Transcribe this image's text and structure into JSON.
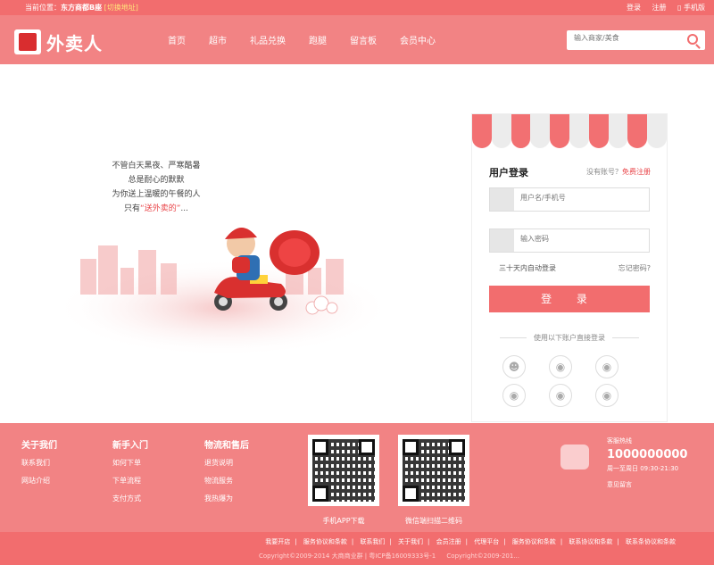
{
  "topbar": {
    "location_prefix": "当前位置：",
    "location": "东方商都B座",
    "switch": "[切换地址]",
    "login": "登录",
    "register": "注册",
    "mobile": "▯ 手机版"
  },
  "header": {
    "brand": "外卖人",
    "nav": [
      "首页",
      "超市",
      "礼品兑换",
      "跑腿",
      "留言板",
      "会员中心"
    ],
    "search_placeholder": "输入商家/美食"
  },
  "hero": {
    "lines": [
      "不管白天黑夜、严寒酷暑",
      "总是耐心的默默",
      "为你送上温暖的午餐的人"
    ],
    "last_prefix": "只有",
    "last_highlight": "“送外卖的”",
    "last_suffix": "..."
  },
  "login": {
    "title": "用户登录",
    "no_account": "没有账号？",
    "register_free": "免费注册",
    "username_placeholder": "用户名/手机号",
    "password_placeholder": "输入密码",
    "auto_login": "三十天内自动登录",
    "forgot": "忘记密码?",
    "submit": "登  录",
    "social_title": "使用以下账户直接登录",
    "socials": [
      "qq-icon",
      "weibo-icon",
      "weibo-icon",
      "weibo-icon",
      "weibo-icon",
      "weibo-icon"
    ],
    "awning_colors": [
      "#f27072",
      "#ececec"
    ]
  },
  "footer": {
    "columns": [
      {
        "title": "关于我们",
        "items": [
          "联系我们",
          "网站介绍"
        ]
      },
      {
        "title": "新手入门",
        "items": [
          "如何下单",
          "下单流程",
          "支付方式"
        ]
      },
      {
        "title": "物流和售后",
        "items": [
          "退货说明",
          "物流服务",
          "我热爆为"
        ]
      }
    ],
    "qr_app": "手机APP下载",
    "qr_wechat": "微信端扫描二维码",
    "hotline_label": "客服热线",
    "hotline": "1000000000",
    "hours": "周一至周日 09:30-21:30",
    "feedback": "意见留言"
  },
  "bottom": {
    "links": [
      "我要开店",
      "服务协议和条款",
      "联系我们",
      "关于我们",
      "会员注册",
      "代理平台",
      "服务协议和条款",
      "联系协议和条款",
      "联系条协议和条款"
    ],
    "copyright": "Copyright©2009-2014 大商商业群 | 粤ICP备16009333号-1",
    "copyright2": "Copyright©2009-201..."
  }
}
